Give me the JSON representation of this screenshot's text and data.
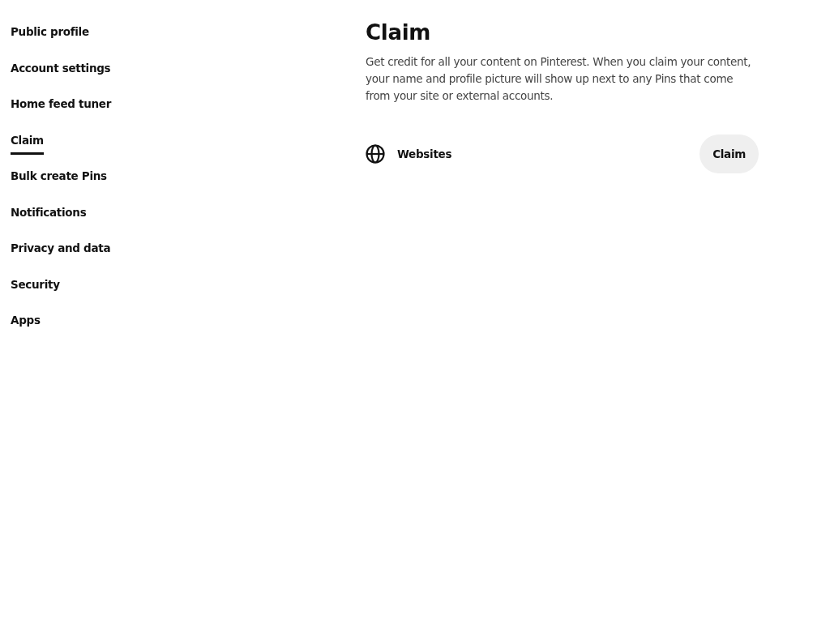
{
  "sidebar": {
    "items": [
      {
        "label": "Public profile",
        "selected": false
      },
      {
        "label": "Account settings",
        "selected": false
      },
      {
        "label": "Home feed tuner",
        "selected": false
      },
      {
        "label": "Claim",
        "selected": true
      },
      {
        "label": "Bulk create Pins",
        "selected": false
      },
      {
        "label": "Notifications",
        "selected": false
      },
      {
        "label": "Privacy and data",
        "selected": false
      },
      {
        "label": "Security",
        "selected": false
      },
      {
        "label": "Apps",
        "selected": false
      }
    ]
  },
  "main": {
    "title": "Claim",
    "description": "Get credit for all your content on Pinterest. When you claim your content, your name and profile picture will show up next to any Pins that come from your site or external accounts.",
    "rows": [
      {
        "label": "Websites",
        "button": "Claim"
      }
    ]
  }
}
